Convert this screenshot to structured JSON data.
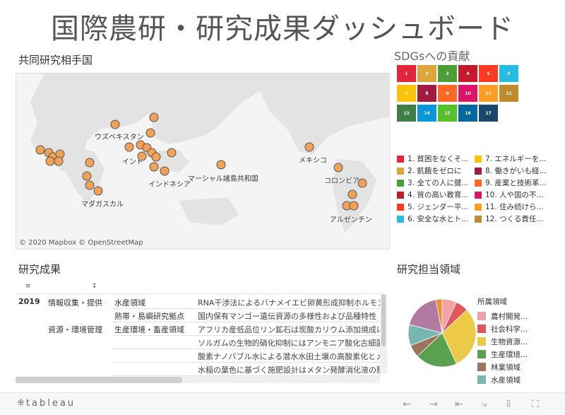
{
  "header": {
    "title": "国際農研・研究成果ダッシュボード"
  },
  "map_section": {
    "label": "共同研究相手国",
    "attribution": "© 2020 Mapbox  © OpenStreetMap",
    "place_labels": [
      "ウズベキスタン",
      "インド",
      "インドネシア",
      "マーシャル諸島共和国",
      "マダガスカル",
      "メキシコ",
      "コロンビア",
      "アルゼンチン"
    ],
    "marker_color": "#f0a356",
    "land_color": "#e3e3e3"
  },
  "sdg_section": {
    "label": "SDGsへの貢献",
    "tiles": [
      {
        "num": "1",
        "color": "#e5243b"
      },
      {
        "num": "2",
        "color": "#dda63a"
      },
      {
        "num": "3",
        "color": "#4c9f38"
      },
      {
        "num": "4",
        "color": "#c5192d"
      },
      {
        "num": "5",
        "color": "#ff3a21"
      },
      {
        "num": "6",
        "color": "#26bde2"
      },
      {
        "num": "7",
        "color": "#fcc30b"
      },
      {
        "num": "8",
        "color": "#a21942"
      },
      {
        "num": "9",
        "color": "#fd6925"
      },
      {
        "num": "10",
        "color": "#dd1367"
      },
      {
        "num": "11",
        "color": "#fd9d24"
      },
      {
        "num": "12",
        "color": "#bf8b2e"
      },
      {
        "num": "13",
        "color": "#3f7e44"
      },
      {
        "num": "14",
        "color": "#0a97d9"
      },
      {
        "num": "15",
        "color": "#56c02b"
      },
      {
        "num": "16",
        "color": "#00689d"
      },
      {
        "num": "17",
        "color": "#19486a"
      }
    ],
    "legend": [
      {
        "label": "1. 貧困をなくそ...",
        "color": "#e5243b"
      },
      {
        "label": "2. 飢餓をゼロに",
        "color": "#dda63a"
      },
      {
        "label": "3. 全ての人に健...",
        "color": "#4c9f38"
      },
      {
        "label": "4. 質の高い教育...",
        "color": "#c5192d"
      },
      {
        "label": "5. ジェンダー平...",
        "color": "#ff3a21"
      },
      {
        "label": "6. 安全な水とト...",
        "color": "#26bde2"
      },
      {
        "label": "7. エネルギーを...",
        "color": "#fcc30b"
      },
      {
        "label": "8. 働きがいも経...",
        "color": "#a21942"
      },
      {
        "label": "9. 産業と技術革...",
        "color": "#fd6925"
      },
      {
        "label": "10. 人や国の不...",
        "color": "#dd1367"
      },
      {
        "label": "11. 住み続けら...",
        "color": "#fd9d24"
      },
      {
        "label": "12. つくる責任...",
        "color": "#bf8b2e"
      }
    ]
  },
  "research_section": {
    "label": "研究成果",
    "rows": [
      {
        "year": "2019",
        "category": "情報収集・提供",
        "field": "水産領域",
        "title": "RNA干渉法によるバナメイエビ卵黄形成抑制ホルモン"
      },
      {
        "year": "",
        "category": "",
        "field": "熱帯・島嶼研究拠点",
        "title": "国内保有マンゴー遺伝資源の多様性および品種特性"
      },
      {
        "year": "",
        "category": "資源・環境管理",
        "field": "生産環境・畜産領域",
        "title": "アフリカ産低品位リン鉱石は炭酸カリウム添加焼成に"
      },
      {
        "year": "",
        "category": "",
        "field": "",
        "title": "ソルガムの生物的硝化抑制にはアンモニア酸化古細菌"
      },
      {
        "year": "",
        "category": "",
        "field": "",
        "title": "酸素ナノバブル水による潜水水田土壌の高酸素化とメ"
      },
      {
        "year": "",
        "category": "",
        "field": "",
        "title": "水稲の葉色に基づく施肥設計はメタン発酵消化液の肥"
      }
    ]
  },
  "domain_section": {
    "label": "研究担当領域",
    "legend_title": "所属領域",
    "slices": [
      {
        "name": "農村開発...",
        "value": 7,
        "color": "#f4a0a8"
      },
      {
        "name": "社会科学...",
        "value": 6,
        "color": "#e15759"
      },
      {
        "name": "生物資源...",
        "value": 30,
        "color": "#edc948"
      },
      {
        "name": "生産環境...",
        "value": 20,
        "color": "#59a14f"
      },
      {
        "name": "林業領域",
        "value": 6,
        "color": "#9c755f"
      },
      {
        "name": "水産領域",
        "value": 10,
        "color": "#76b7b2"
      },
      {
        "name": "",
        "value": 18,
        "color": "#b07aa1"
      },
      {
        "name": "",
        "value": 3,
        "color": "#f28e2b"
      }
    ]
  },
  "footer": {
    "brand": "tableau",
    "buttons": [
      "undo-icon",
      "redo-icon",
      "revert-icon",
      "share-icon",
      "download-icon",
      "fullscreen-icon"
    ]
  }
}
